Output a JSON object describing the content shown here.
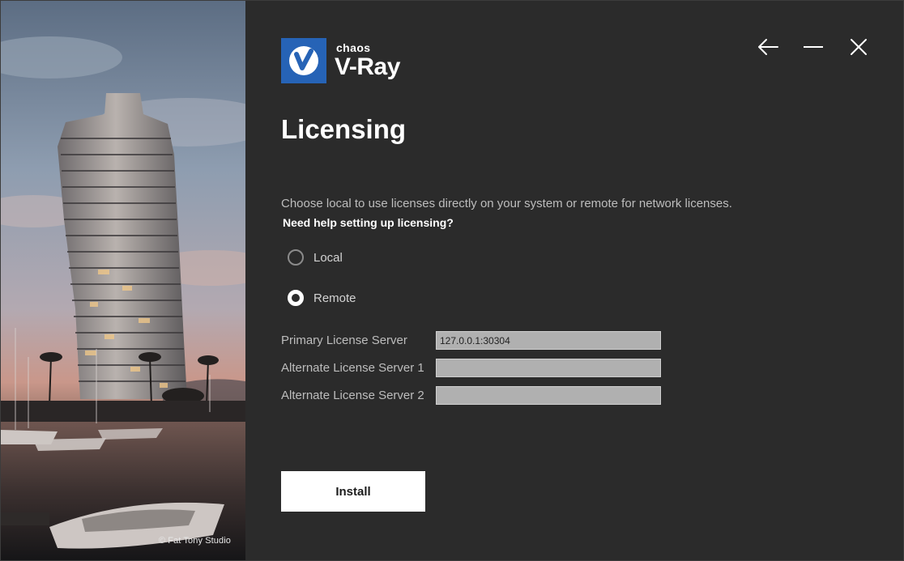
{
  "brand": {
    "company": "chaos",
    "product": "V-Ray",
    "accent_color": "#2663b6"
  },
  "photo_credit": "© Fat Tony Studio",
  "window_controls": {
    "back_icon": "arrow-left-icon",
    "minimize_icon": "minimize-icon",
    "close_icon": "close-icon"
  },
  "page": {
    "title": "Licensing",
    "description": "Choose local to use licenses directly on your system or remote for network licenses.",
    "help_link": "Need help setting up licensing?"
  },
  "license_mode": {
    "selected": "remote",
    "options": [
      {
        "id": "local",
        "label": "Local"
      },
      {
        "id": "remote",
        "label": "Remote"
      }
    ]
  },
  "servers": [
    {
      "label": "Primary License Server",
      "value": "127.0.0.1:30304"
    },
    {
      "label": "Alternate License Server 1",
      "value": ""
    },
    {
      "label": "Alternate License Server 2",
      "value": ""
    }
  ],
  "install_label": "Install"
}
